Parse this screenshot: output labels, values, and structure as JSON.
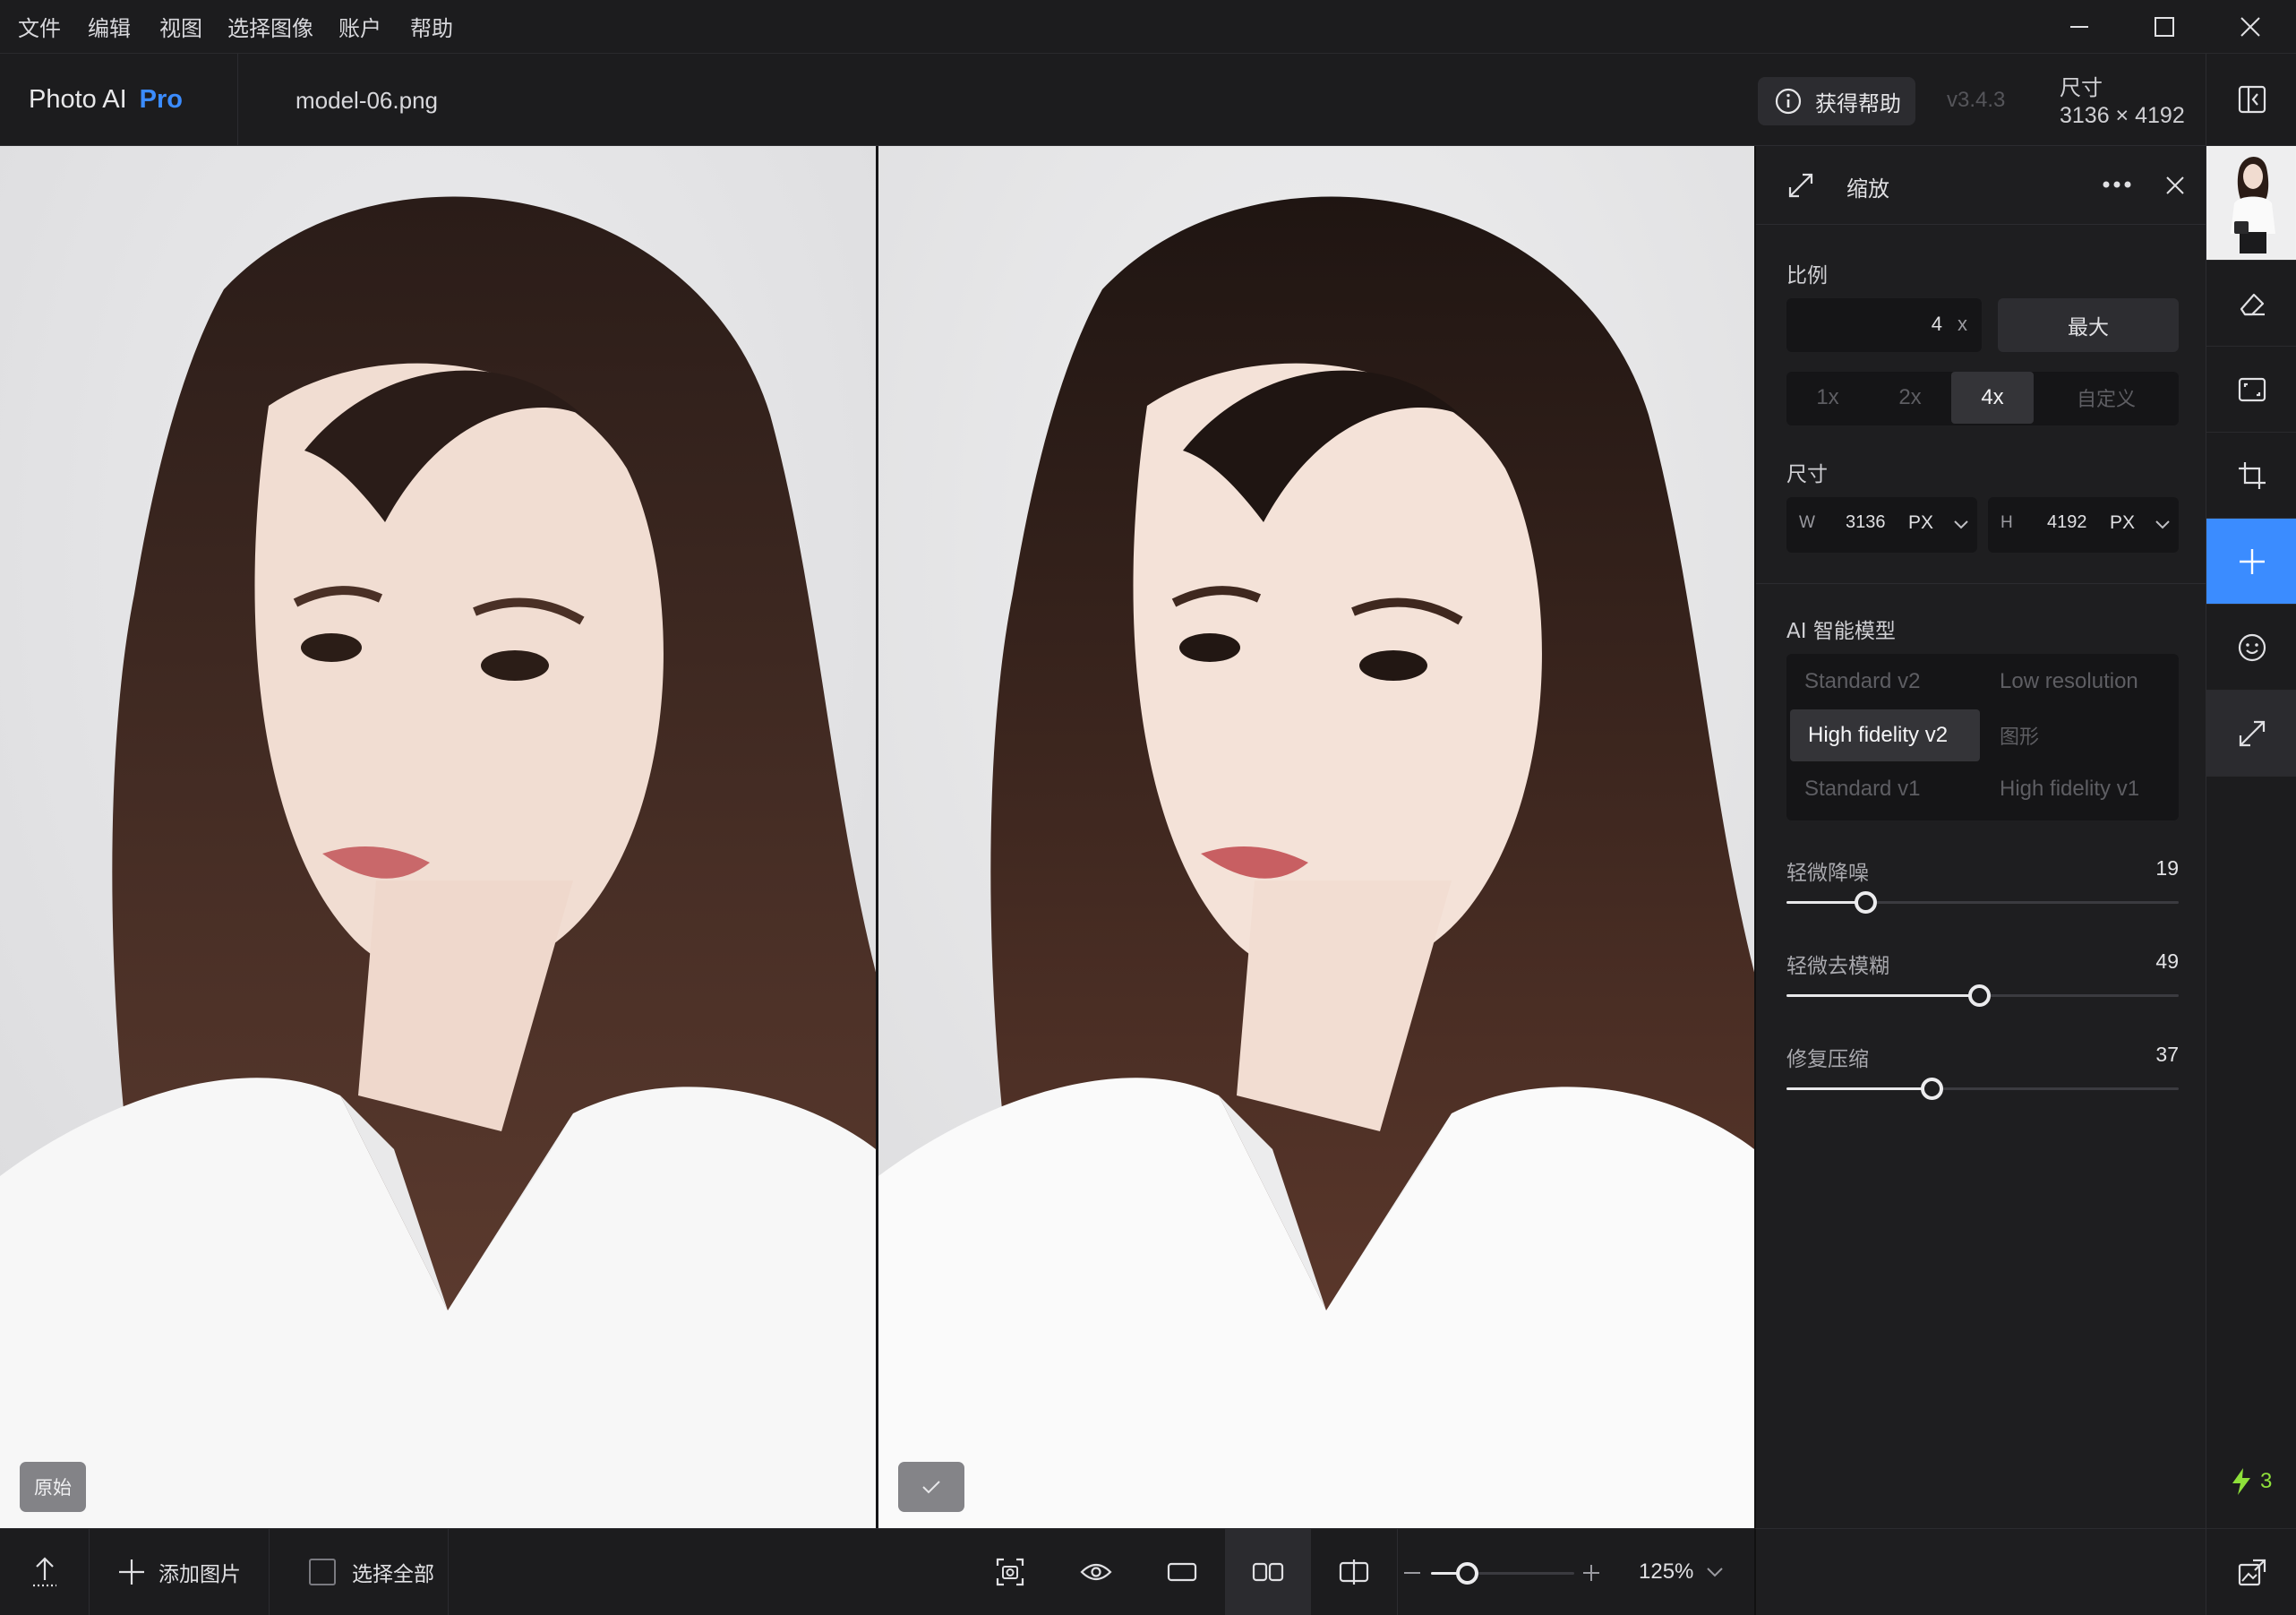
{
  "menubar": {
    "items": [
      "文件",
      "编辑",
      "视图",
      "选择图像",
      "账户",
      "帮助"
    ]
  },
  "header": {
    "app_name": "Photo AI",
    "app_tier": "Pro",
    "file_name": "model-06.png",
    "help_label": "获得帮助",
    "version": "v3.4.3",
    "size_label": "尺寸",
    "size_value": "3136 × 4192"
  },
  "canvas": {
    "left_tag": "原始",
    "right_tag_icon": "check-icon"
  },
  "panel": {
    "title": "缩放",
    "scale": {
      "label": "比例",
      "value": "4",
      "unit": "x",
      "max_label": "最大",
      "presets": [
        "1x",
        "2x",
        "4x",
        "自定义"
      ],
      "selected": "4x"
    },
    "dimensions": {
      "label": "尺寸",
      "width_label": "W",
      "width_value": "3136",
      "width_unit": "PX",
      "height_label": "H",
      "height_value": "4192",
      "height_unit": "PX"
    },
    "ai_model": {
      "label": "AI 智能模型",
      "models": [
        "Standard v2",
        "Low resolution",
        "High fidelity v2",
        "图形",
        "Standard v1",
        "High fidelity v1"
      ],
      "selected": "High fidelity v2"
    },
    "sliders": [
      {
        "label": "轻微降噪",
        "value": 19,
        "fraction": 0.2
      },
      {
        "label": "轻微去模糊",
        "value": 49,
        "fraction": 0.49
      },
      {
        "label": "修复压缩",
        "value": 37,
        "fraction": 0.37
      }
    ]
  },
  "toolbar": {
    "credits": "3",
    "accent": "#3b8cff",
    "credit_color": "#8ee03a"
  },
  "bottombar": {
    "add_image_label": "添加图片",
    "select_all_label": "选择全部",
    "zoom_value": "125%",
    "zoom_fraction": 0.25
  }
}
